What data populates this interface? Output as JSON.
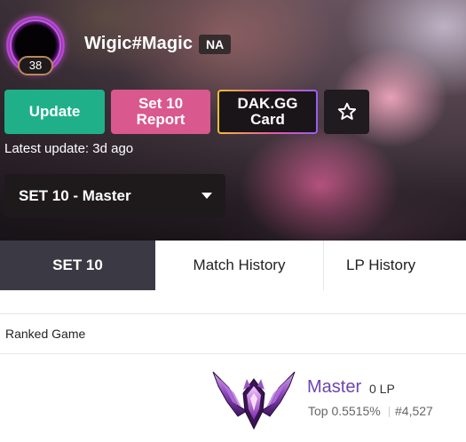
{
  "profile": {
    "summoner_name": "Wigic#Magic",
    "region": "NA",
    "level": "38",
    "latest_update": "Latest update: 3d ago"
  },
  "actions": {
    "update_label": "Update",
    "report_label": "Set 10 Report",
    "card_label": "DAK.GG Card",
    "favorite_icon": "star-icon"
  },
  "season_select": {
    "selected": "SET 10 - Master"
  },
  "tabs": [
    {
      "label": "SET 10",
      "active": true
    },
    {
      "label": "Match History",
      "active": false
    },
    {
      "label": "LP History",
      "active": false
    }
  ],
  "ranked": {
    "section_title": "Ranked Game",
    "tier": "Master",
    "lp": "0 LP",
    "top_percent": "Top 0.5515%",
    "rank": "#4,527",
    "emblem_icon": "master-emblem-icon"
  },
  "colors": {
    "update": "#1fb08a",
    "report": "#d9588e",
    "tab_active": "#3b3a44",
    "tier_text": "#6d44b3"
  }
}
